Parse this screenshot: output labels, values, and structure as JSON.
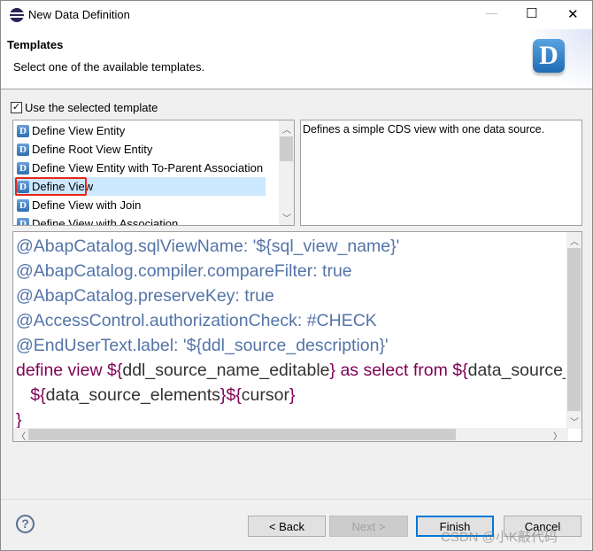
{
  "window": {
    "title": "New Data Definition",
    "minimize": "—",
    "maximize": "☐",
    "close": "✕"
  },
  "header": {
    "title": "Templates",
    "subtitle": "Select one of the available templates.",
    "logo_letter": "D"
  },
  "use_template": {
    "label": "Use the selected template",
    "checked": true
  },
  "templates": {
    "items": [
      "Define View Entity",
      "Define Root View Entity",
      "Define View Entity with To-Parent Association",
      "Define View",
      "Define View with Join",
      "Define View with Association"
    ],
    "selected": "Define View",
    "icon": "D"
  },
  "description": "Defines a simple CDS view with one data source.",
  "code": {
    "lines": [
      "@AbapCatalog.sqlViewName: '${sql_view_name}'",
      "@AbapCatalog.compiler.compareFilter: true",
      "@AbapCatalog.preserveKey: true",
      "@AccessControl.authorizationCheck: #CHECK",
      "@EndUserText.label: '${ddl_source_description}'"
    ],
    "define_kw": "define view ${",
    "define_name": "ddl_source_name_editable",
    "define_kw2": "} as select from ${",
    "define_src": "data_source_name}",
    "l7a": "${",
    "l7b": "data_source_elements",
    "l7c": "}${",
    "l7d": "cursor",
    "l7e": "}",
    "close": "}"
  },
  "colors": {
    "annotation": "#5474a8",
    "keyword": "#7f0055",
    "selection": "#cce8ff",
    "highlight_box": "#e8261c",
    "default_button_border": "#0078d7"
  },
  "buttons": {
    "help": "?",
    "back": "< Back",
    "next": "Next >",
    "finish": "Finish",
    "cancel": "Cancel"
  },
  "watermark": "CSDN @小K敲代码"
}
